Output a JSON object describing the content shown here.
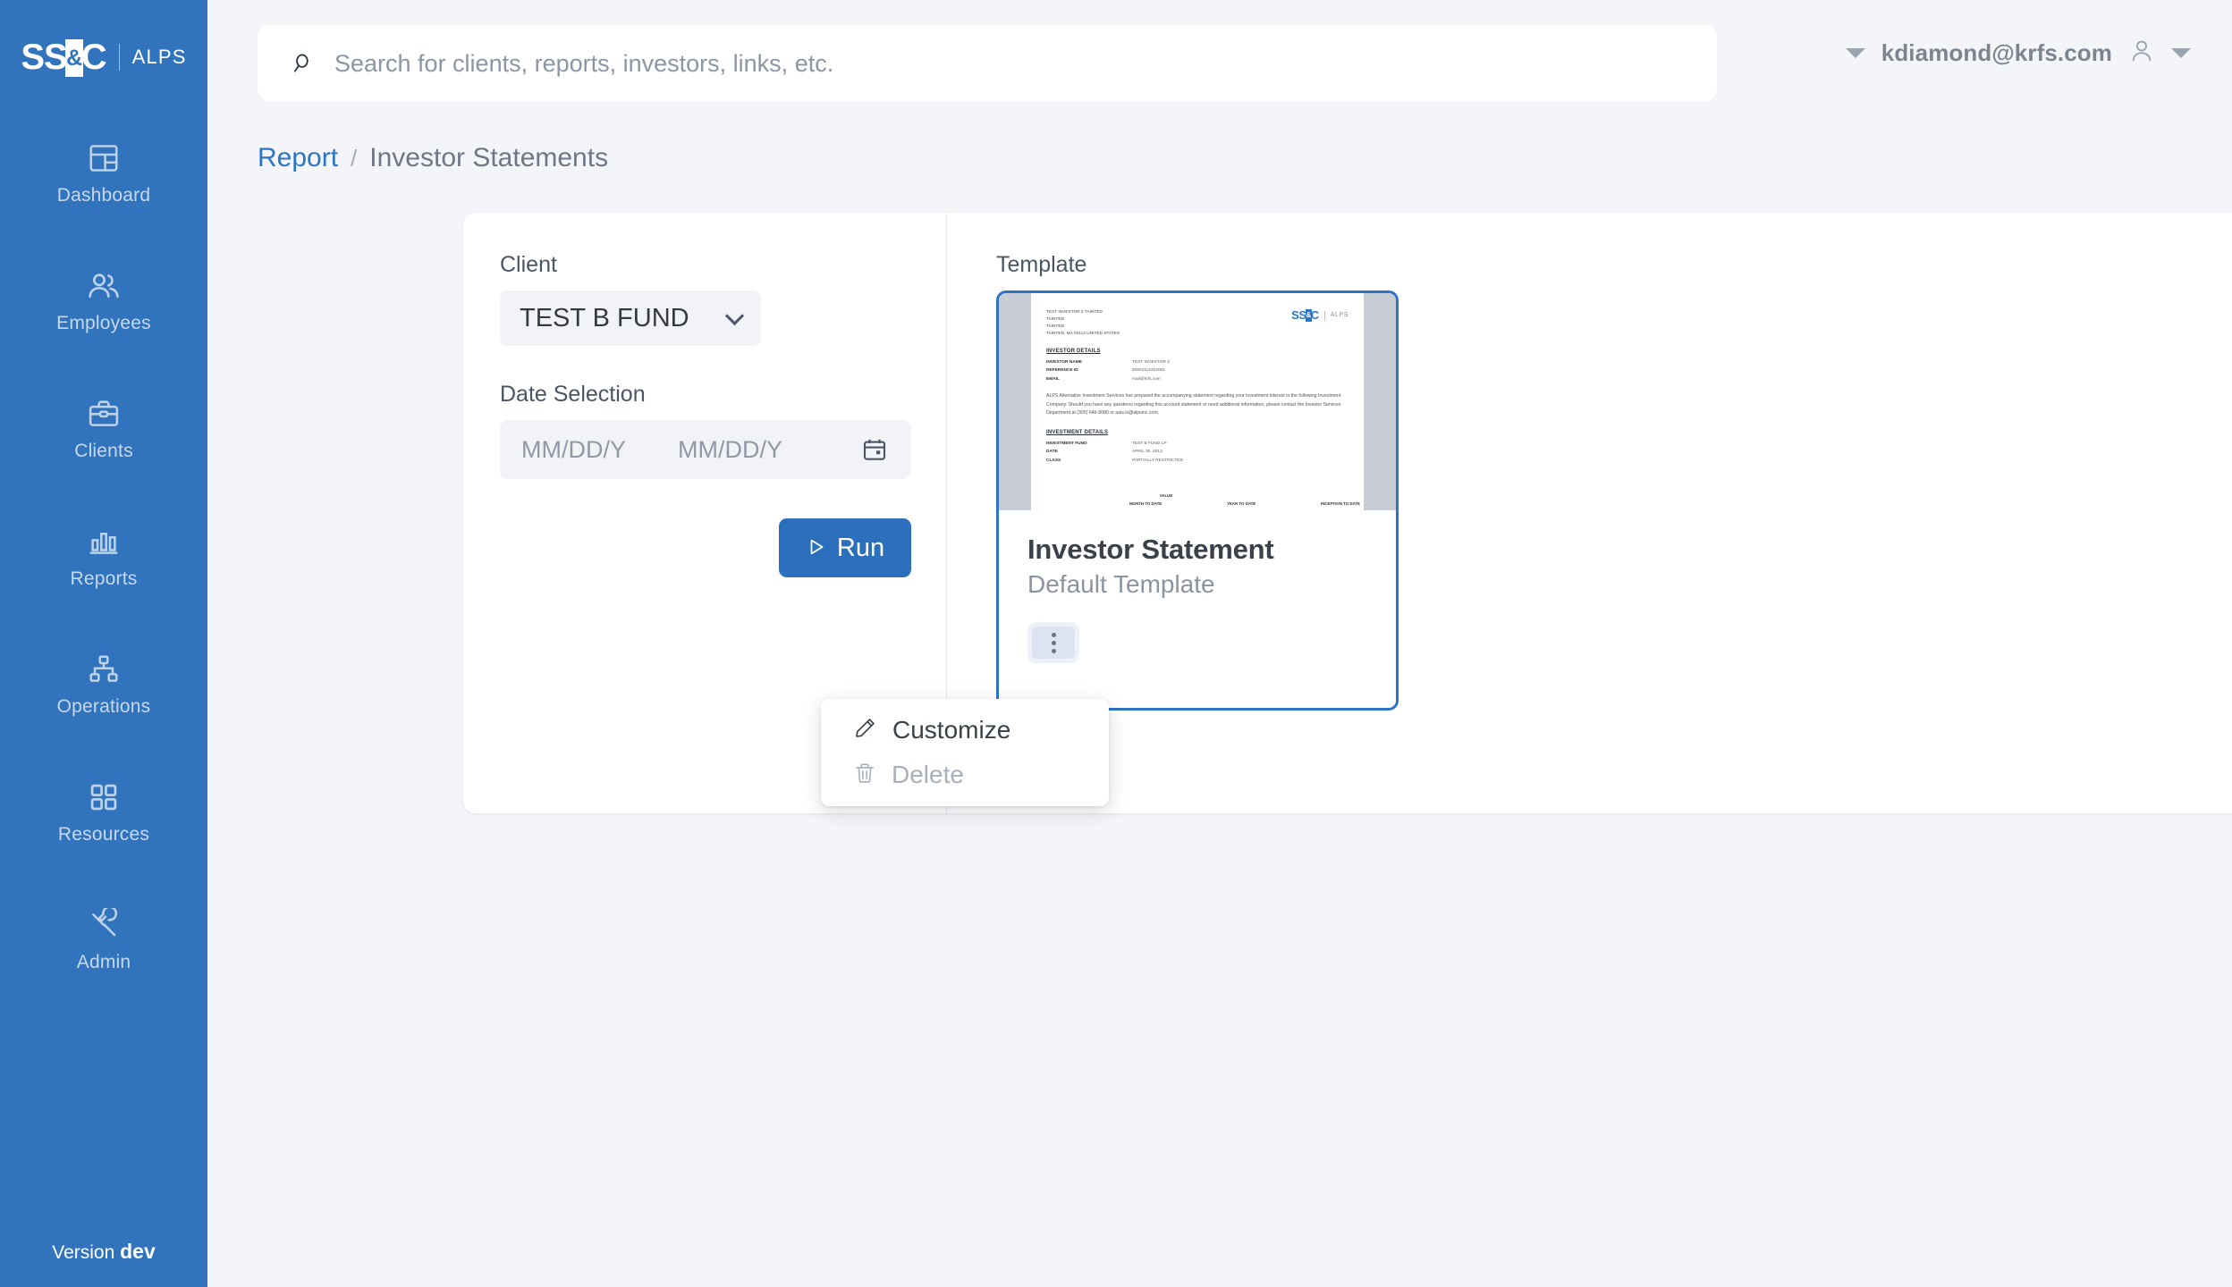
{
  "brand": {
    "logo_main": "SS",
    "logo_amp": "&",
    "logo_c": "C",
    "logo_sub": "ALPS"
  },
  "sidebar": {
    "items": [
      {
        "label": "Dashboard",
        "icon": "dashboard-icon"
      },
      {
        "label": "Employees",
        "icon": "employees-icon"
      },
      {
        "label": "Clients",
        "icon": "briefcase-icon"
      },
      {
        "label": "Reports",
        "icon": "bar-chart-icon"
      },
      {
        "label": "Operations",
        "icon": "sitemap-icon"
      },
      {
        "label": "Resources",
        "icon": "grid-icon"
      },
      {
        "label": "Admin",
        "icon": "wrench-icon"
      }
    ],
    "version_prefix": "Version",
    "version_value": "dev",
    "background": "#3174bd"
  },
  "topbar": {
    "search_placeholder": "Search for clients, reports, investors, links, etc.",
    "search_value": "",
    "user_email": "kdiamond@krfs.com"
  },
  "breadcrumb": {
    "parent": "Report",
    "separator": "/",
    "current": "Investor Statements"
  },
  "form": {
    "client_label": "Client",
    "client_value": "TEST B FUND",
    "date_label": "Date Selection",
    "date_start_placeholder": "MM/DD/Y",
    "date_start_value": "",
    "date_end_placeholder": "MM/DD/Y",
    "date_end_value": "",
    "run_label": "Run"
  },
  "template_section": {
    "label": "Template",
    "card": {
      "title": "Investor Statement",
      "subtitle": "Default Template",
      "selected_border_color": "#2c74c4"
    },
    "preview": {
      "address": [
        "TEST INVESTOR 2 TAINTED",
        "TAINTED",
        "TAINTED",
        "TAINTED, MA 02113 UNITED STATES"
      ],
      "investor_details_heading": "INVESTOR DETAILS",
      "investor_details": [
        {
          "key": "INVESTOR NAME",
          "value": "TEST INVESTOR 2"
        },
        {
          "key": "REFERENCE ID",
          "value": "80803112222001"
        },
        {
          "key": "EMAIL",
          "value": "mail@krfs.com"
        }
      ],
      "paragraph": "ALPS Alternative Investment Services has prepared the accompanying statement regarding your investment interest in the following Investment Company. Should you have any questions regarding this account statement or need additional information, please contact the Investor Services Department at (305) 646-8080 or aais.is@alpsinc.com.",
      "investment_details_heading": "INVESTMENT DETAILS",
      "investment_details": [
        {
          "key": "INVESTMENT FUND",
          "value": "TEST B FUND LP"
        },
        {
          "key": "DATE",
          "value": "APRIL 30, 2013"
        },
        {
          "key": "CLASS",
          "value": "PARTIALLY RESTRICTED"
        }
      ],
      "value_header": "VALUE",
      "column_headers": [
        "MONTH TO DATE",
        "YEAR TO DATE",
        "INCEPTION TO DATE"
      ]
    }
  },
  "dropdown": {
    "items": [
      {
        "label": "Customize",
        "icon": "pencil-icon",
        "disabled": false
      },
      {
        "label": "Delete",
        "icon": "trash-icon",
        "disabled": true
      }
    ]
  }
}
